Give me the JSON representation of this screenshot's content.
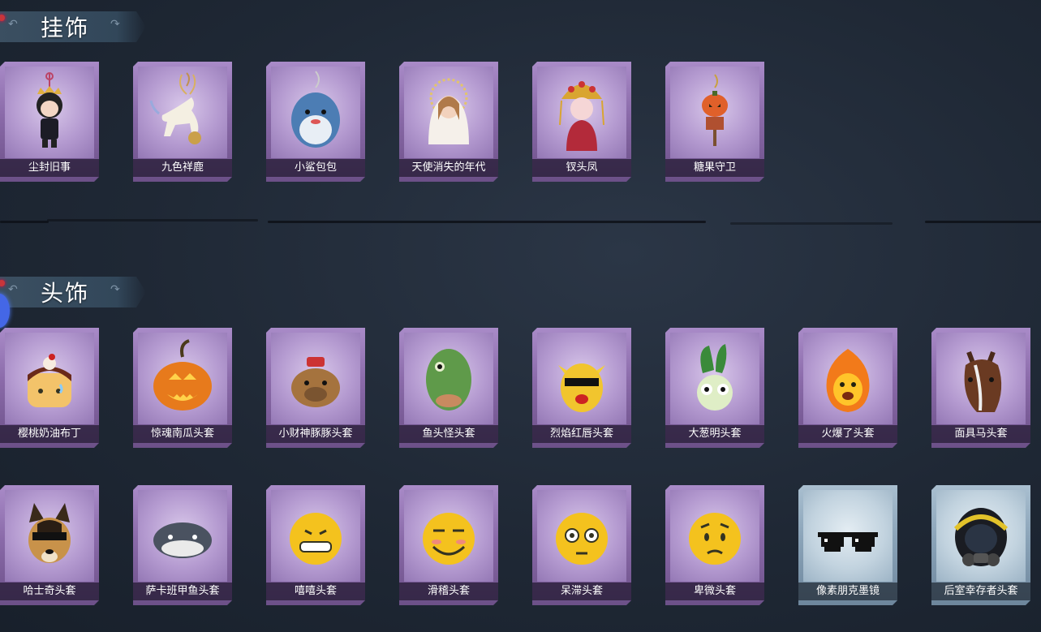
{
  "sections": [
    {
      "title": "挂饰",
      "items": [
        "尘封旧事",
        "九色祥鹿",
        "小鲨包包",
        "天使消失的年代",
        "钗头凤",
        "糖果守卫"
      ]
    },
    {
      "title": "头饰",
      "items": [
        "樱桃奶油布丁",
        "惊魂南瓜头套",
        "小财神豚豚头套",
        "鱼头怪头套",
        "烈焰红唇头套",
        "大葱明头套",
        "火爆了头套",
        "面具马头套",
        "哈士奇头套",
        "萨卡班甲鱼头套",
        "嘻嘻头套",
        "滑稽头套",
        "呆滞头套",
        "卑微头套",
        "像素朋克墨镜",
        "后室幸存者头套"
      ]
    }
  ],
  "colors": {
    "purple_card": "#a98bc8",
    "blue_card": "#a9bfd0",
    "background": "#1f2835"
  },
  "blue_items": [
    "像素朋克墨镜",
    "后室幸存者头套"
  ]
}
